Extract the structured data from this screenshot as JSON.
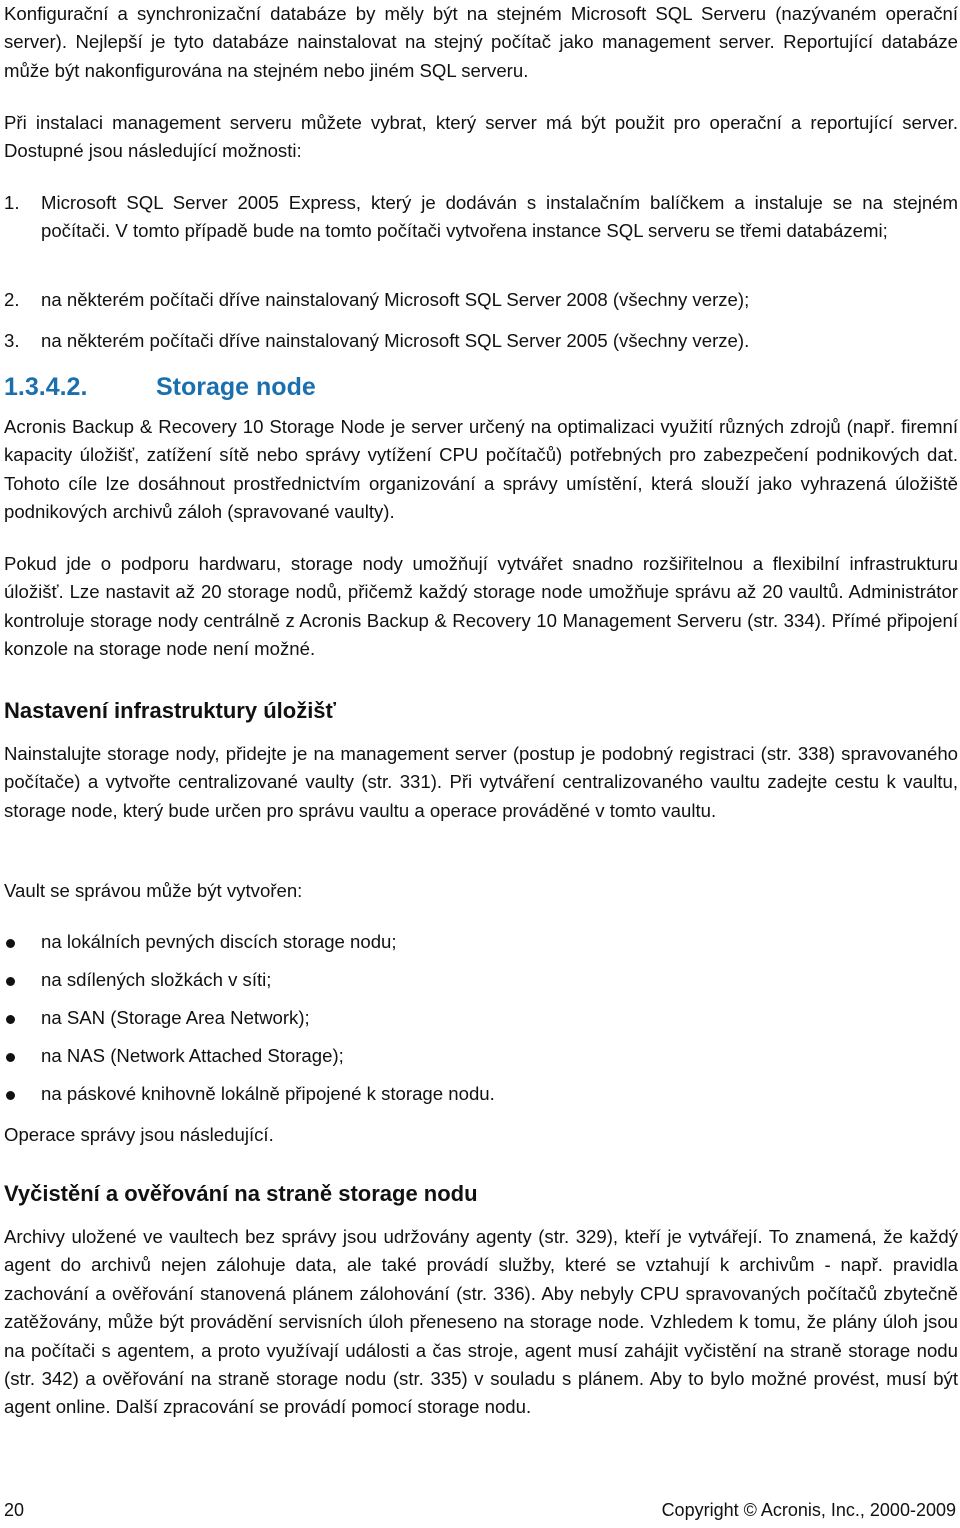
{
  "intro": {
    "para1": "Konfigurační a synchronizační databáze by měly být na stejném Microsoft SQL Serveru (nazývaném operační server). Nejlepší je tyto databáze nainstalovat na stejný počítač jako management server. Reportující databáze může být nakonfigurována na stejném nebo jiném SQL serveru.",
    "para2": "Při instalaci management serveru můžete vybrat, který server má být použit pro operační a reportující server. Dostupné jsou následující možnosti:"
  },
  "options": [
    {
      "num": "1.",
      "text": "Microsoft SQL Server 2005 Express, který je dodáván s instalačním balíčkem a instaluje se na stejném počítači. V tomto případě bude na tomto počítači vytvořena instance SQL serveru se třemi databázemi;"
    },
    {
      "num": "2.",
      "text": "na některém počítači dříve nainstalovaný Microsoft SQL Server 2008 (všechny verze);"
    },
    {
      "num": "3.",
      "text": "na některém počítači dříve nainstalovaný Microsoft SQL Server 2005 (všechny verze)."
    }
  ],
  "section": {
    "number": "1.3.4.2.",
    "title": "Storage node",
    "color": "#1a6fae",
    "para1": "Acronis Backup & Recovery 10 Storage Node je server určený na optimalizaci využití různých zdrojů (např. firemní kapacity úložišť, zatížení sítě nebo správy vytížení CPU počítačů) potřebných pro zabezpečení podnikových dat. Tohoto cíle lze dosáhnout prostřednictvím organizování a správy umístění, která slouží jako vyhrazená úložiště podnikových archivů záloh (spravované vaulty).",
    "para2": "Pokud jde o podporu hardwaru, storage nody umožňují vytvářet snadno rozšiřitelnou a flexibilní infrastrukturu úložišť. Lze nastavit až 20 storage nodů, přičemž každý storage node umožňuje správu až 20 vaultů. Administrátor kontroluje storage nody centrálně z Acronis Backup & Recovery 10 Management Serveru (str.  334). Přímé připojení konzole na storage node není možné."
  },
  "infra": {
    "heading": "Nastavení infrastruktury úložišť",
    "para1": "Nainstalujte storage nody, přidejte je na management server (postup je podobný registraci (str.  338) spravovaného počítače) a vytvořte centralizované vaulty (str.  331). Při vytváření centralizovaného vaultu zadejte cestu k vaultu, storage node, který bude určen pro správu vaultu a operace prováděné v tomto vaultu.",
    "para2": "Vault se správou může být vytvořen:",
    "bullets": [
      "na lokálních pevných discích storage nodu;",
      "na sdílených složkách v síti;",
      "na SAN (Storage Area Network);",
      "na NAS (Network Attached Storage);",
      "na páskové knihovně lokálně připojené k storage nodu."
    ],
    "para3": "Operace správy jsou následující."
  },
  "cleanup": {
    "heading": "Vyčistění a ověřování na straně storage nodu",
    "para1": "Archivy uložené ve vaultech bez správy jsou udržovány agenty (str.  329), kteří je vytvářejí. To znamená, že každý agent do archivů nejen zálohuje data, ale také provádí služby, které se vztahují k archivům - např. pravidla zachování a ověřování stanovená plánem zálohování (str.  336). Aby nebyly CPU spravovaných počítačů zbytečně zatěžovány, může být provádění servisních úloh přeneseno na storage node. Vzhledem k tomu, že plány úloh jsou na počítači s agentem, a proto využívají události a čas stroje, agent musí zahájit vyčistění na straně storage nodu (str.  342) a ověřování na straně storage nodu (str.  335) v souladu s plánem. Aby to bylo možné provést, musí být agent online. Další zpracování se provádí pomocí storage nodu."
  },
  "footer": {
    "page_number": "20",
    "copyright": "Copyright © Acronis, Inc., 2000-2009"
  }
}
